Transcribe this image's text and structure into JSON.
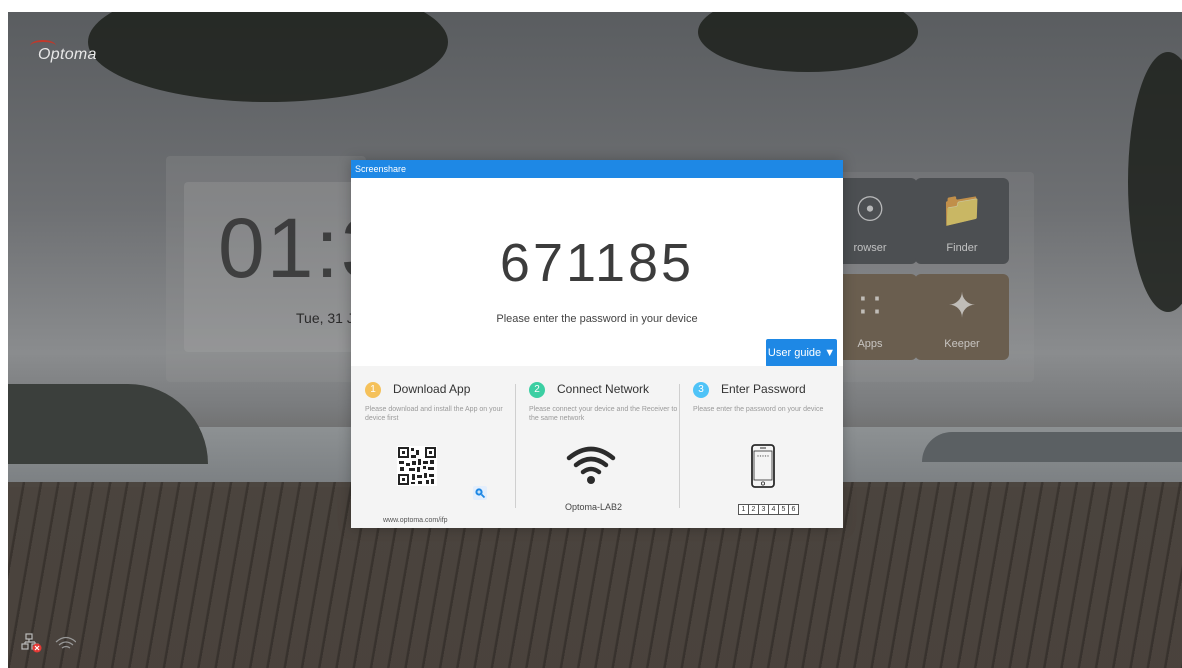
{
  "brand": {
    "logo_text": "Optoma",
    "accent": "#c0392b"
  },
  "home": {
    "clock_time": "01:3",
    "date": "Tue, 31 J",
    "tiles": [
      {
        "label": "rowser",
        "icon": "globe-icon"
      },
      {
        "label": "Finder",
        "icon": "folder-search-icon"
      },
      {
        "label": "Apps",
        "icon": "apps-grid-icon"
      },
      {
        "label": "Keeper",
        "icon": "broom-icon"
      }
    ]
  },
  "status": {
    "network": "network-disconnected-icon",
    "wifi": "wifi-icon"
  },
  "dialog": {
    "title": "Screenshare",
    "header_color": "#1e88e5",
    "pin": "671185",
    "instruction": "Please enter the password in your device",
    "user_guide_label": "User guide",
    "steps": [
      {
        "num": "1",
        "title": "Download App",
        "desc": "Please download and install the App on your device first",
        "url": "www.optoma.com/ifp"
      },
      {
        "num": "2",
        "title": "Connect Network",
        "desc": "Please connect your device and the Receiver to the same network",
        "network_name": "Optoma-LAB2"
      },
      {
        "num": "3",
        "title": "Enter Password",
        "desc": "Please enter the password on your device",
        "boxes": [
          "1",
          "2",
          "3",
          "4",
          "5",
          "6"
        ]
      }
    ]
  }
}
